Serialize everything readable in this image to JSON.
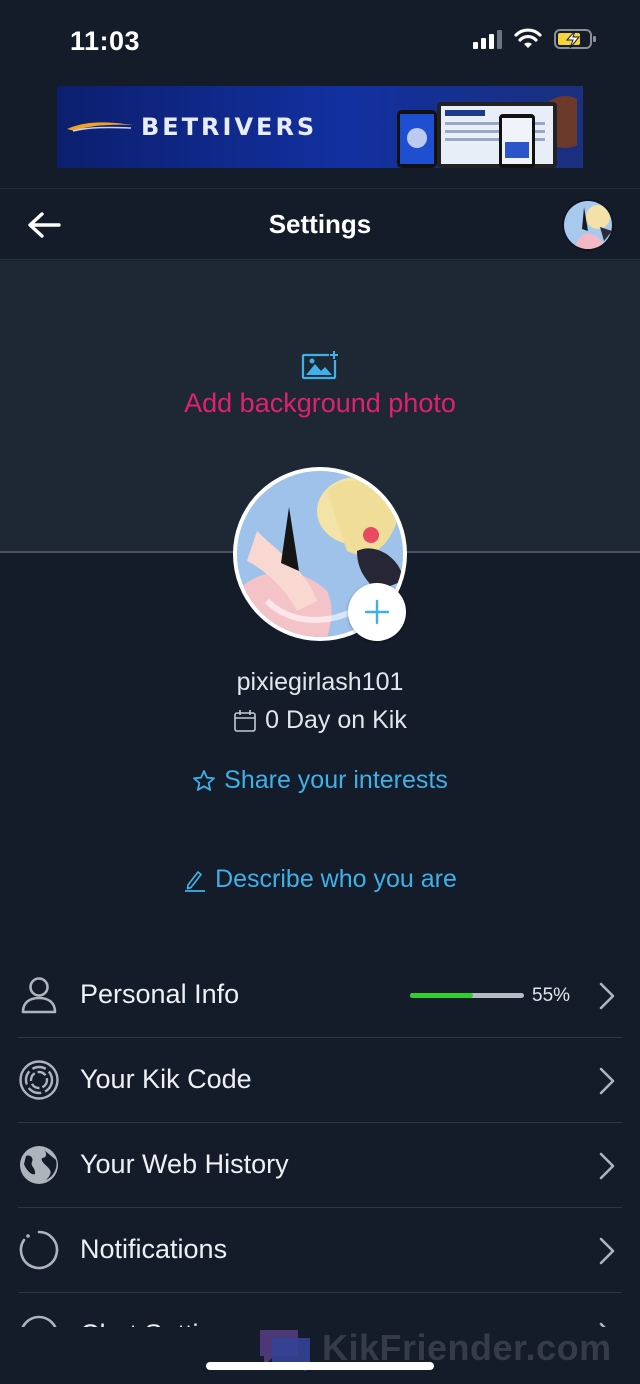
{
  "status_bar": {
    "time": "11:03"
  },
  "ad": {
    "brand": "BETRIVERS"
  },
  "header": {
    "title": "Settings"
  },
  "background": {
    "add_label": "Add background photo"
  },
  "profile": {
    "username": "pixiegirlash101",
    "days_on": "0 Day on Kik",
    "share_interests": "Share your interests",
    "describe": "Describe who you are"
  },
  "menu": {
    "items": [
      {
        "label": "Personal Info",
        "progress_text": "55%",
        "progress": 0.55
      },
      {
        "label": "Your Kik Code"
      },
      {
        "label": "Your Web History"
      },
      {
        "label": "Notifications"
      },
      {
        "label": "Chat Settings"
      }
    ]
  },
  "watermark": {
    "text": "KikFriender.com"
  },
  "colors": {
    "accent_pink": "#e0216b",
    "link_blue": "#3fb0e8",
    "progress_green": "#32cd32",
    "background": "#131c28"
  }
}
